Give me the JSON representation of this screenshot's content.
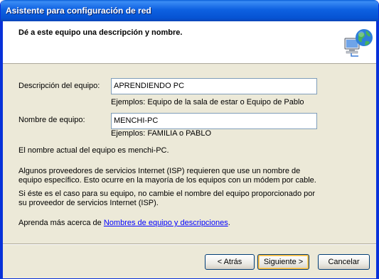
{
  "window": {
    "title": "Asistente para configuración de red"
  },
  "header": {
    "heading": "Dé a este equipo una descripción y nombre.",
    "icon": "network-globe-icon"
  },
  "form": {
    "description_label": "Descripción del equipo:",
    "description_value": "APRENDIENDO PC",
    "description_hint": "Ejemplos: Equipo de la sala de estar o Equipo de Pablo",
    "name_label": "Nombre de equipo:",
    "name_value": "MENCHI-PC",
    "name_hint": "Ejemplos: FAMILIA o PABLO"
  },
  "info": {
    "current_name": "El nombre actual del equipo es menchi-PC.",
    "isp_note": "Algunos proveedores de servicios Internet (ISP) requieren que use un nombre de equipo específico. Esto ocurre en la mayoría de los equipos con un módem por cable.",
    "isp_advice": "Si éste es el caso para su equipo, no cambie el nombre del equipo proporcionado por su proveedor de servicios Internet (ISP).",
    "learn_more_prefix": "Aprenda más acerca de ",
    "learn_more_link": "Nombres de equipo y descripciones",
    "learn_more_suffix": "."
  },
  "buttons": {
    "back": "< Atrás",
    "next": "Siguiente >",
    "cancel": "Cancelar"
  },
  "colors": {
    "titlebar": "#0a5fd8",
    "dialog_bg": "#ece9d8",
    "link": "#0000ff"
  }
}
